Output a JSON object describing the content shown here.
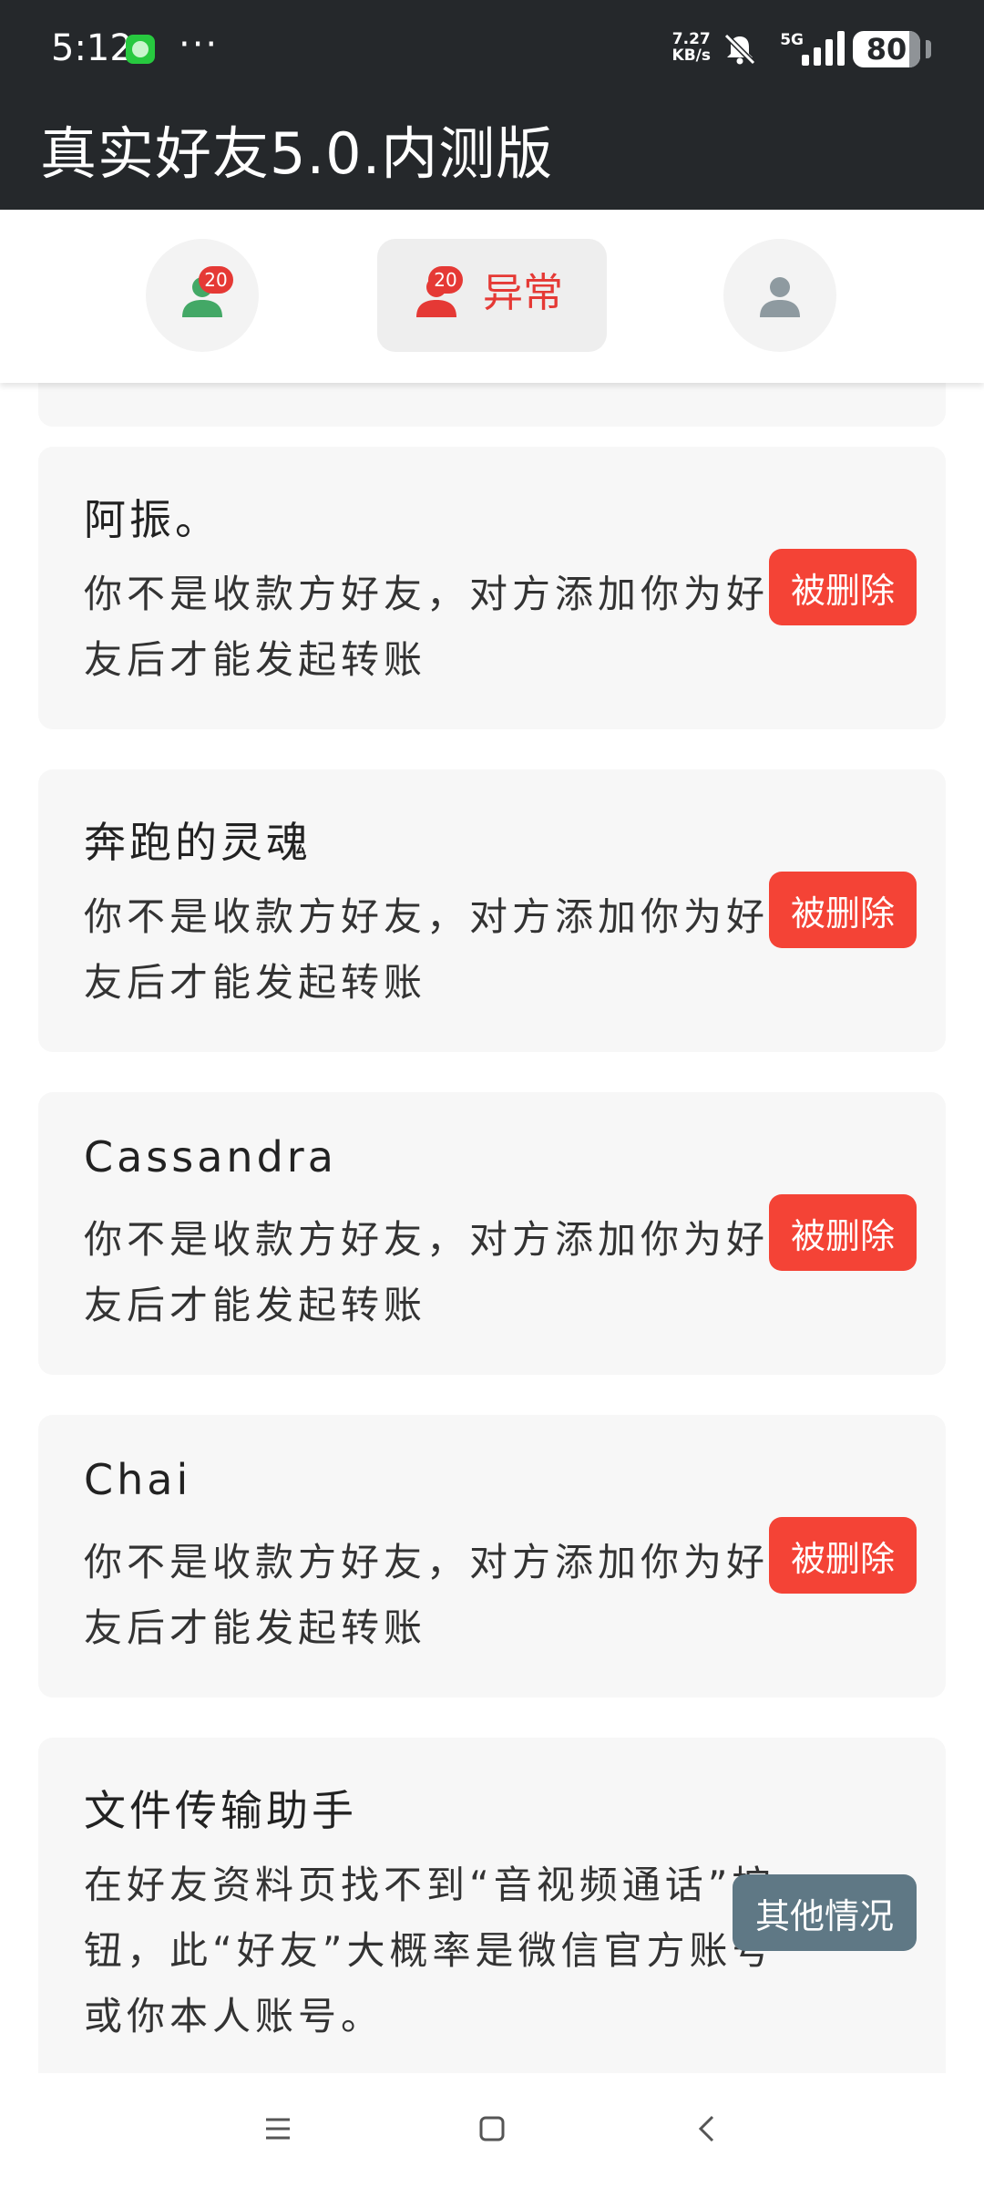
{
  "status_bar": {
    "time": "5:12",
    "more_dots": "···",
    "net_speed": "7.27\nKB/s",
    "network": "5G",
    "battery": "80"
  },
  "app": {
    "title": "真实好友5.0.内测版"
  },
  "tabs": {
    "normal": {
      "badge": "20",
      "icon": "person-icon",
      "color": "#43a866"
    },
    "abnormal": {
      "badge": "20",
      "label": "异常",
      "icon": "person-icon",
      "color": "#e53935"
    },
    "profile": {
      "icon": "person-icon",
      "color": "#8e9aa0"
    }
  },
  "friends": [
    {
      "name": "阿振。",
      "desc": "你不是收款方好友，对方添加你为好友后才能发起转账",
      "status": "被删除"
    },
    {
      "name": "奔跑的灵魂",
      "desc": "你不是收款方好友，对方添加你为好友后才能发起转账",
      "status": "被删除"
    },
    {
      "name": "Cassandra",
      "desc": "你不是收款方好友，对方添加你为好友后才能发起转账",
      "status": "被删除"
    },
    {
      "name": "Chai",
      "desc": "你不是收款方好友，对方添加你为好友后才能发起转账",
      "status": "被删除"
    },
    {
      "name": "文件传输助手",
      "desc": "在好友资料页找不到“音视频通话”按钮，此“好友”大概率是微信官方账号或你本人账号。",
      "status": "其他情况"
    }
  ],
  "colors": {
    "header_bg": "#25282b",
    "deleted_button": "#f44336",
    "other_button": "#5f7885",
    "card_bg": "#f7f7f7"
  }
}
